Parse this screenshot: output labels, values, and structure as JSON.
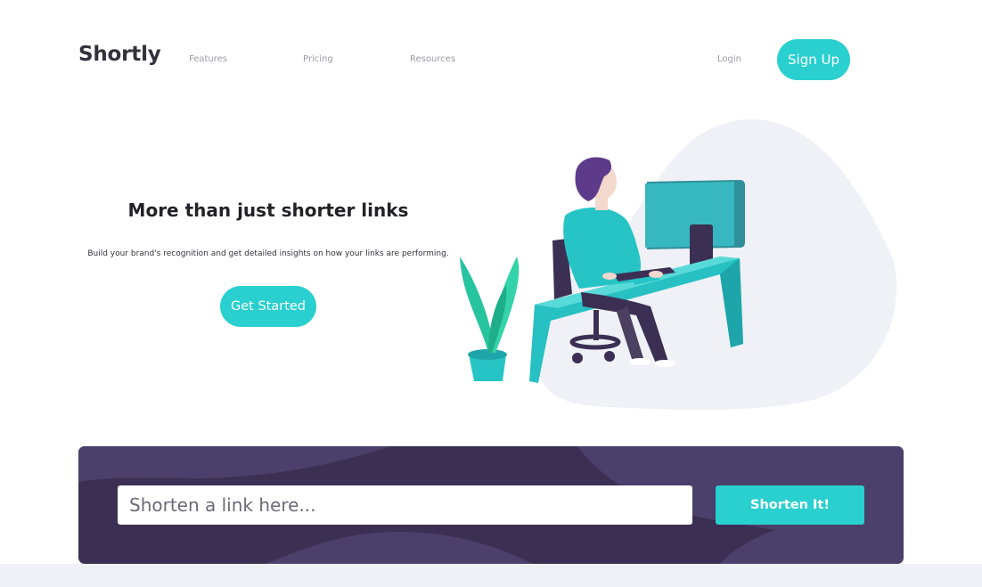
{
  "header": {
    "logo": "Shortly",
    "nav": [
      {
        "label": "Features"
      },
      {
        "label": "Pricing"
      },
      {
        "label": "Resources"
      }
    ],
    "login_label": "Login",
    "signup_label": "Sign Up"
  },
  "hero": {
    "title": "More than just shorter links",
    "text": "Build your brand's recognition and get detailed insights on how your links are performing.",
    "cta_label": "Get Started",
    "illustration_icon": "person-working-illustration"
  },
  "shorten": {
    "placeholder": "Shorten a link here...",
    "value": "",
    "button_label": "Shorten It!"
  },
  "colors": {
    "accent": "#2acfcf",
    "dark_violet": "#3b3054",
    "text_dark": "#34313d",
    "gray": "#9e9aa7",
    "light_bg": "#eff1f7"
  }
}
